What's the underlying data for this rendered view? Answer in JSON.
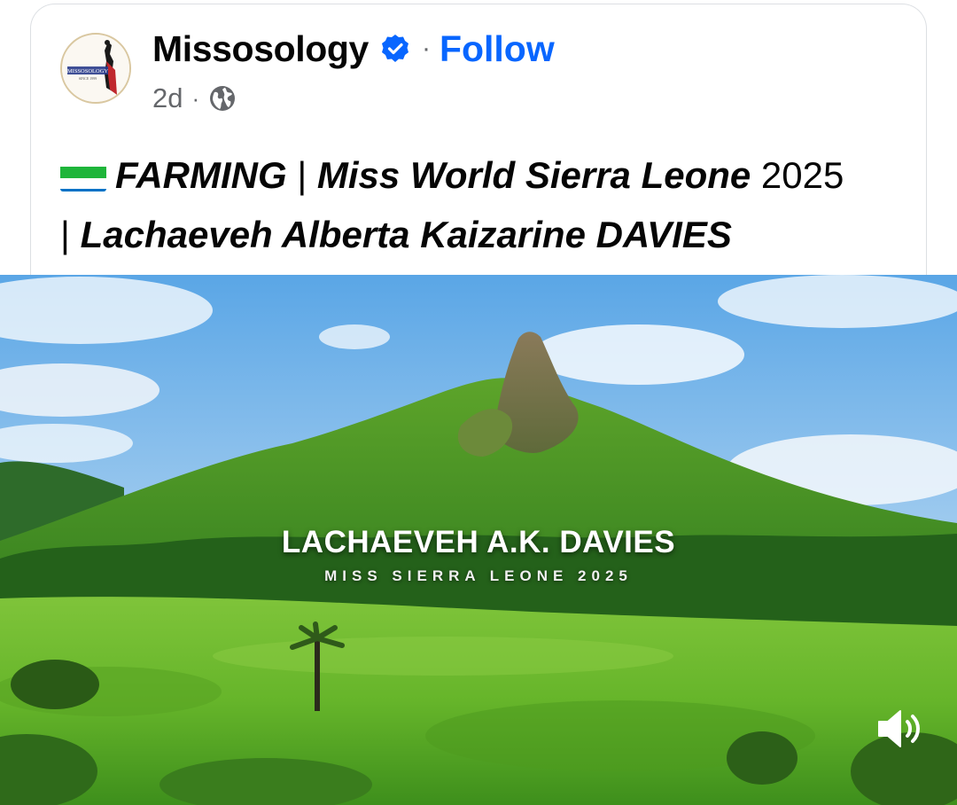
{
  "post": {
    "page_name": "Missosology",
    "follow_label": "Follow",
    "time": "2d",
    "separator": "·",
    "avatar_text": "MISSOSOLOGY",
    "avatar_since": "SINCE 1999",
    "caption": {
      "flag_icon": "sierra-leone-flag",
      "part1": "FARMING",
      "sep1": " | ",
      "part2": "Miss World Sierra Leone",
      "year": " 2025",
      "sep2": "| ",
      "part3": "Lachaeveh Alberta Kaizarine DAVIES"
    }
  },
  "video": {
    "overlay_title": "LACHAEVEH A.K. DAVIES",
    "overlay_subtitle": "MISS SIERRA LEONE 2025",
    "sound_icon": "speaker-volume-icon"
  },
  "colors": {
    "accent": "#0866ff",
    "text": "#050505",
    "muted": "#65676b",
    "flag_green": "#1eb53a",
    "flag_white": "#ffffff",
    "flag_blue": "#0072c6"
  }
}
